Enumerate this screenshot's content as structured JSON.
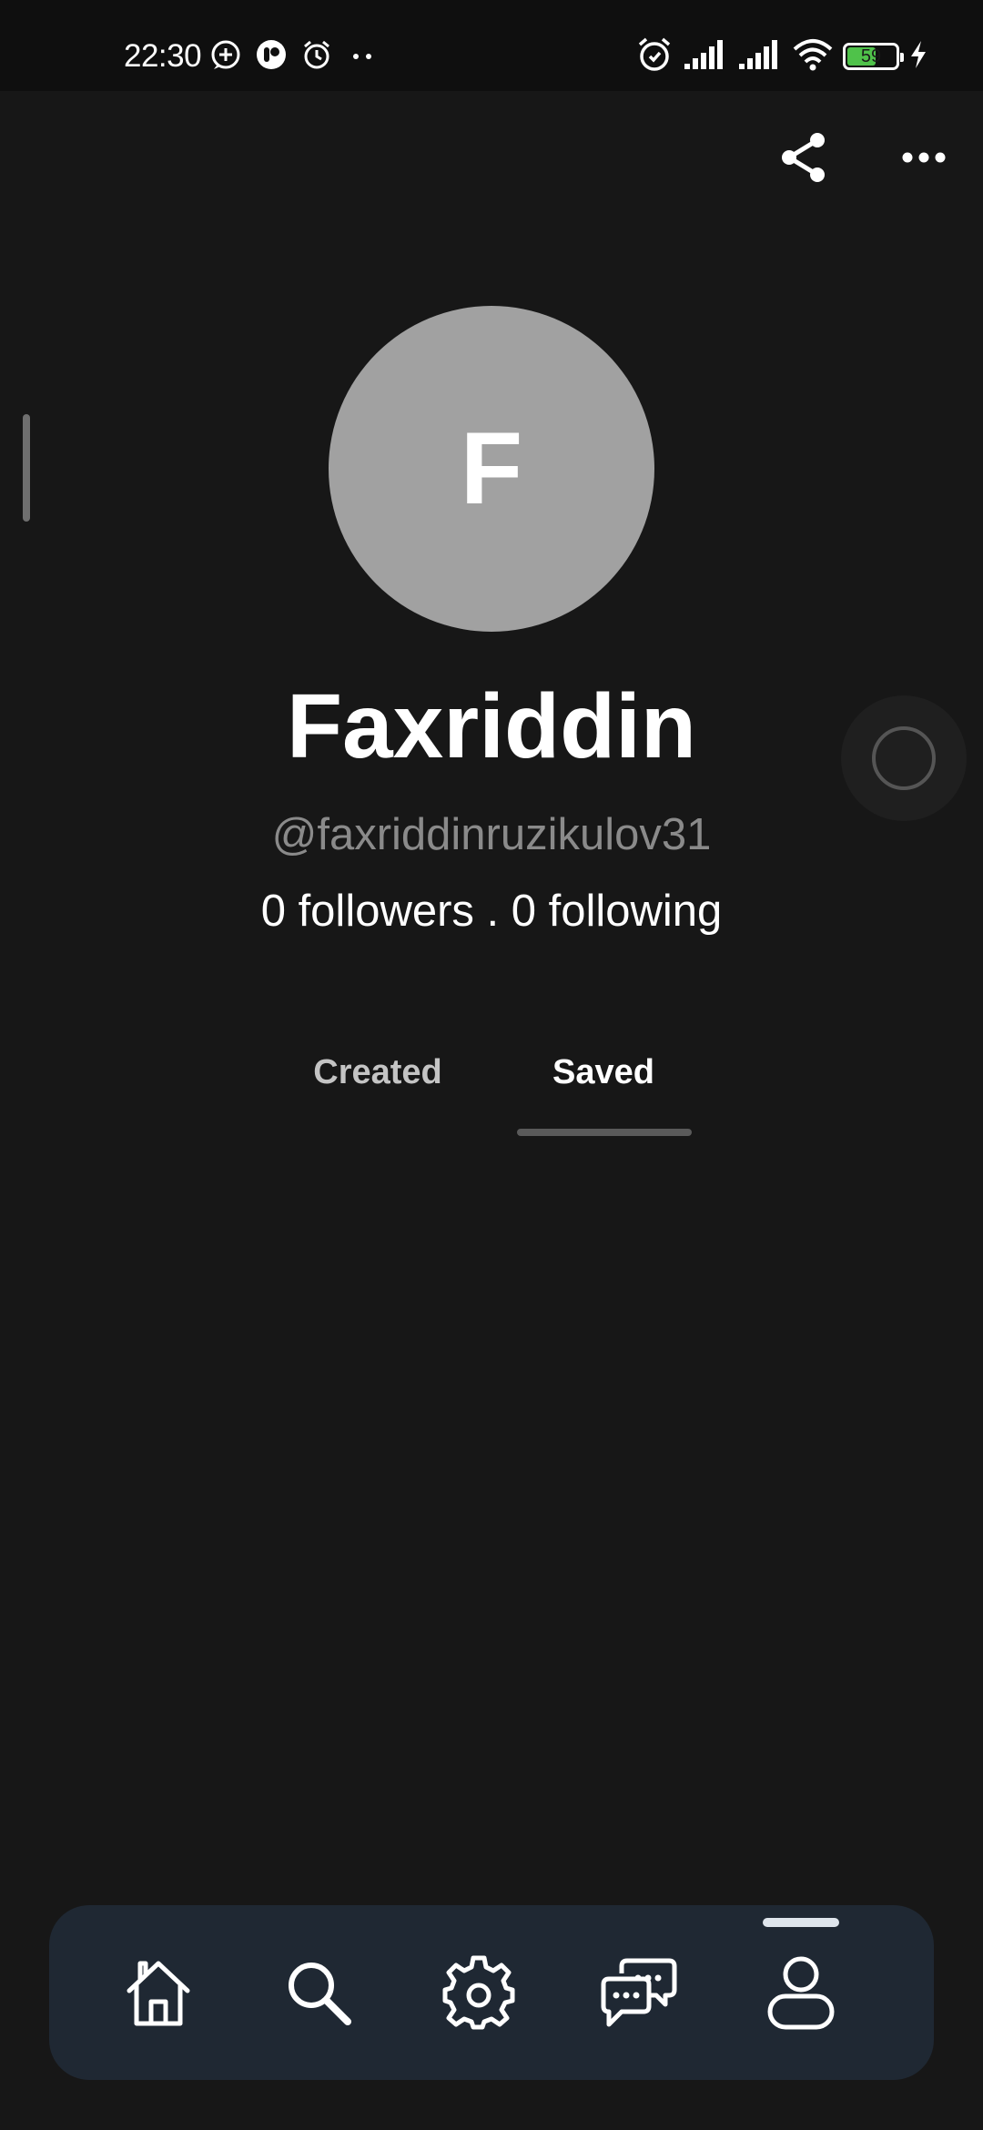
{
  "status_bar": {
    "time": "22:30",
    "battery_level": "59",
    "battery_fraction": 0.59,
    "left_icons": [
      "add-circle-icon",
      "app-notification-icon",
      "alarm-icon",
      "more-dots-icon"
    ],
    "right_icons": [
      "alarm-clock-icon",
      "signal-icon",
      "signal-icon",
      "wifi-icon",
      "battery-icon",
      "charging-bolt-icon"
    ]
  },
  "top_actions": {
    "share_icon": "share-icon",
    "more_icon": "more-horizontal-icon"
  },
  "profile": {
    "avatar_letter": "F",
    "name": "Faxriddin",
    "handle": "@faxriddinruzikulov31",
    "stats": "0 followers . 0 following"
  },
  "tabs": [
    {
      "label": "Created",
      "active": false
    },
    {
      "label": "Saved",
      "active": true
    }
  ],
  "bottom_nav": {
    "items": [
      "home-icon",
      "search-icon",
      "gear-icon",
      "chat-bubbles-icon",
      "profile-icon"
    ],
    "active": "profile-icon"
  },
  "colors": {
    "background": "#171717",
    "status_bar": "#0f0f0f",
    "avatar": "#a1a1a1",
    "handle_text": "#8a8a8a",
    "nav_bar": "#1f2833",
    "battery_fill": "#4fc24a"
  }
}
